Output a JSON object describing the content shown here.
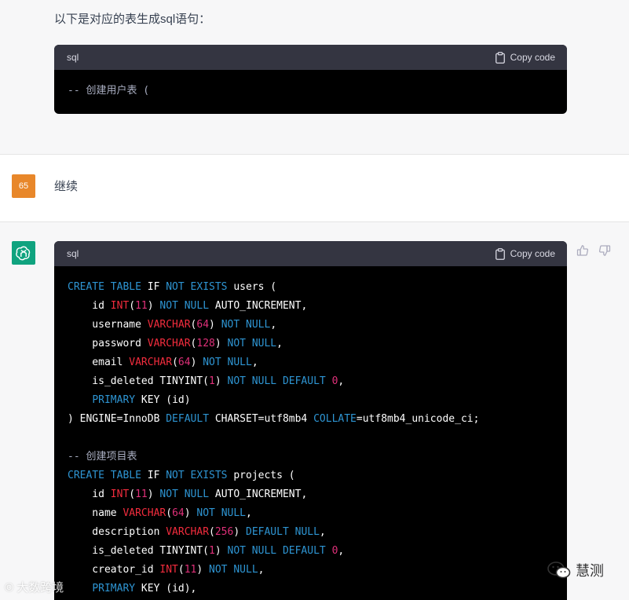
{
  "message_1": {
    "intro": "以下是对应的表生成sql语句：",
    "code": {
      "language": "sql",
      "copy_label": "Copy code",
      "lines": [
        [
          {
            "t": "-- 创建用户表 (",
            "c": "cm"
          }
        ]
      ]
    }
  },
  "user_message": {
    "avatar_label": "65",
    "text": "继续"
  },
  "message_2": {
    "code": {
      "language": "sql",
      "copy_label": "Copy code",
      "lines": [
        [
          {
            "t": "CREATE TABLE",
            "c": "kw"
          },
          {
            "t": " "
          },
          {
            "t": "IF",
            "c": "pl"
          },
          {
            "t": " "
          },
          {
            "t": "NOT EXISTS",
            "c": "kw"
          },
          {
            "t": " users ("
          }
        ],
        [
          {
            "t": "    id "
          },
          {
            "t": "INT",
            "c": "fn"
          },
          {
            "t": "("
          },
          {
            "t": "11",
            "c": "num"
          },
          {
            "t": ") "
          },
          {
            "t": "NOT NULL",
            "c": "kw"
          },
          {
            "t": " AUTO_INCREMENT,"
          }
        ],
        [
          {
            "t": "    username "
          },
          {
            "t": "VARCHAR",
            "c": "fn"
          },
          {
            "t": "("
          },
          {
            "t": "64",
            "c": "num"
          },
          {
            "t": ") "
          },
          {
            "t": "NOT NULL",
            "c": "kw"
          },
          {
            "t": ","
          }
        ],
        [
          {
            "t": "    password "
          },
          {
            "t": "VARCHAR",
            "c": "fn"
          },
          {
            "t": "("
          },
          {
            "t": "128",
            "c": "num"
          },
          {
            "t": ") "
          },
          {
            "t": "NOT NULL",
            "c": "kw"
          },
          {
            "t": ","
          }
        ],
        [
          {
            "t": "    email "
          },
          {
            "t": "VARCHAR",
            "c": "fn"
          },
          {
            "t": "("
          },
          {
            "t": "64",
            "c": "num"
          },
          {
            "t": ") "
          },
          {
            "t": "NOT NULL",
            "c": "kw"
          },
          {
            "t": ","
          }
        ],
        [
          {
            "t": "    is_deleted TINYINT("
          },
          {
            "t": "1",
            "c": "num"
          },
          {
            "t": ") "
          },
          {
            "t": "NOT NULL DEFAULT",
            "c": "kw"
          },
          {
            "t": " "
          },
          {
            "t": "0",
            "c": "num"
          },
          {
            "t": ","
          }
        ],
        [
          {
            "t": "    "
          },
          {
            "t": "PRIMARY",
            "c": "kw"
          },
          {
            "t": " KEY (id)"
          }
        ],
        [
          {
            "t": ") ENGINE=InnoDB "
          },
          {
            "t": "DEFAULT",
            "c": "kw"
          },
          {
            "t": " CHARSET=utf8mb4 "
          },
          {
            "t": "COLLATE",
            "c": "kw"
          },
          {
            "t": "=utf8mb4_unicode_ci;"
          }
        ],
        [
          {
            "t": ""
          }
        ],
        [
          {
            "t": "-- 创建项目表",
            "c": "cm"
          }
        ],
        [
          {
            "t": "CREATE TABLE",
            "c": "kw"
          },
          {
            "t": " IF "
          },
          {
            "t": "NOT EXISTS",
            "c": "kw"
          },
          {
            "t": " projects ("
          }
        ],
        [
          {
            "t": "    id "
          },
          {
            "t": "INT",
            "c": "fn"
          },
          {
            "t": "("
          },
          {
            "t": "11",
            "c": "num"
          },
          {
            "t": ") "
          },
          {
            "t": "NOT NULL",
            "c": "kw"
          },
          {
            "t": " AUTO_INCREMENT,"
          }
        ],
        [
          {
            "t": "    name "
          },
          {
            "t": "VARCHAR",
            "c": "fn"
          },
          {
            "t": "("
          },
          {
            "t": "64",
            "c": "num"
          },
          {
            "t": ") "
          },
          {
            "t": "NOT NULL",
            "c": "kw"
          },
          {
            "t": ","
          }
        ],
        [
          {
            "t": "    description "
          },
          {
            "t": "VARCHAR",
            "c": "fn"
          },
          {
            "t": "("
          },
          {
            "t": "256",
            "c": "num"
          },
          {
            "t": ") "
          },
          {
            "t": "DEFAULT NULL",
            "c": "kw"
          },
          {
            "t": ","
          }
        ],
        [
          {
            "t": "    is_deleted TINYINT("
          },
          {
            "t": "1",
            "c": "num"
          },
          {
            "t": ") "
          },
          {
            "t": "NOT NULL DEFAULT",
            "c": "kw"
          },
          {
            "t": " "
          },
          {
            "t": "0",
            "c": "num"
          },
          {
            "t": ","
          }
        ],
        [
          {
            "t": "    creator_id "
          },
          {
            "t": "INT",
            "c": "fn"
          },
          {
            "t": "("
          },
          {
            "t": "11",
            "c": "num"
          },
          {
            "t": ") "
          },
          {
            "t": "NOT NULL",
            "c": "kw"
          },
          {
            "t": ","
          }
        ],
        [
          {
            "t": "    "
          },
          {
            "t": "PRIMARY",
            "c": "kw"
          },
          {
            "t": " KEY (id),"
          }
        ]
      ]
    }
  },
  "watermarks": {
    "left": "© 大数跨境",
    "right": "慧测"
  },
  "colors": {
    "keyword": "#2e95d3",
    "function": "#f22c3d",
    "number": "#df3079",
    "comment": "#a9aec1",
    "bot_avatar": "#10a37f",
    "user_avatar": "#e8872a"
  },
  "icons": {
    "copy": "clipboard-icon",
    "bot": "openai-logo-icon",
    "like": "thumbs-up-icon",
    "dislike": "thumbs-down-icon",
    "watermark": "wechat-icon"
  }
}
